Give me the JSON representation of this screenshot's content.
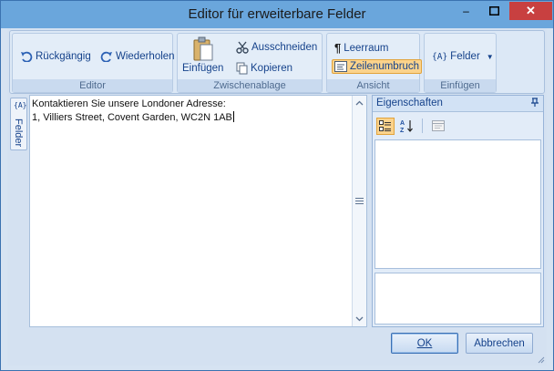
{
  "window": {
    "title": "Editor für erweiterbare Felder",
    "controls": {
      "minimize": "–",
      "maximize": "□",
      "close": "✕"
    }
  },
  "ribbon": {
    "groups": [
      {
        "label": "Editor",
        "items": [
          {
            "label": "Rückgängig",
            "icon": "undo-icon"
          },
          {
            "label": "Wiederholen",
            "icon": "redo-icon"
          }
        ]
      },
      {
        "label": "Zwischenablage",
        "items": [
          {
            "label": "Einfügen",
            "icon": "paste-icon"
          },
          {
            "label": "Ausschneiden",
            "icon": "scissors-icon"
          },
          {
            "label": "Kopieren",
            "icon": "copy-icon"
          }
        ]
      },
      {
        "label": "Ansicht",
        "items": [
          {
            "label": "Leerraum",
            "icon": "pilcrow-icon"
          },
          {
            "label": "Zeilenumbruch",
            "icon": "word-wrap-icon",
            "checked": true
          }
        ]
      },
      {
        "label": "Einfügen",
        "items": [
          {
            "label": "Felder",
            "icon": "fields-icon",
            "dropdown": true
          }
        ]
      }
    ]
  },
  "sidetab": {
    "label": "Felder",
    "icon": "{A}"
  },
  "editor": {
    "lines": [
      "Kontaktieren Sie unsere Londoner Adresse:",
      "1, Villiers Street, Covent Garden, WC2N 1AB"
    ]
  },
  "properties": {
    "title": "Eigenschaften",
    "pin_icon": "pin-icon"
  },
  "buttons": {
    "ok": "OK",
    "cancel": "Abbrechen"
  },
  "colors": {
    "accent": "#15428b",
    "title_bar": "#6aa6dc",
    "checked_bg": "#fbd38c",
    "close_btn": "#c84040"
  }
}
